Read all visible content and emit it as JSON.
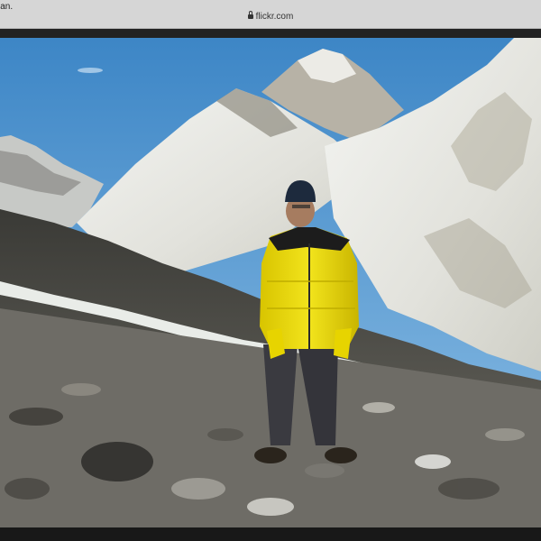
{
  "browser": {
    "tab_title": "lan.",
    "url": "flickr.com",
    "lock_icon": "lock-icon"
  },
  "photo": {
    "subject_icon": "person-in-yellow-jacket",
    "scene": "mountain-landscape"
  }
}
